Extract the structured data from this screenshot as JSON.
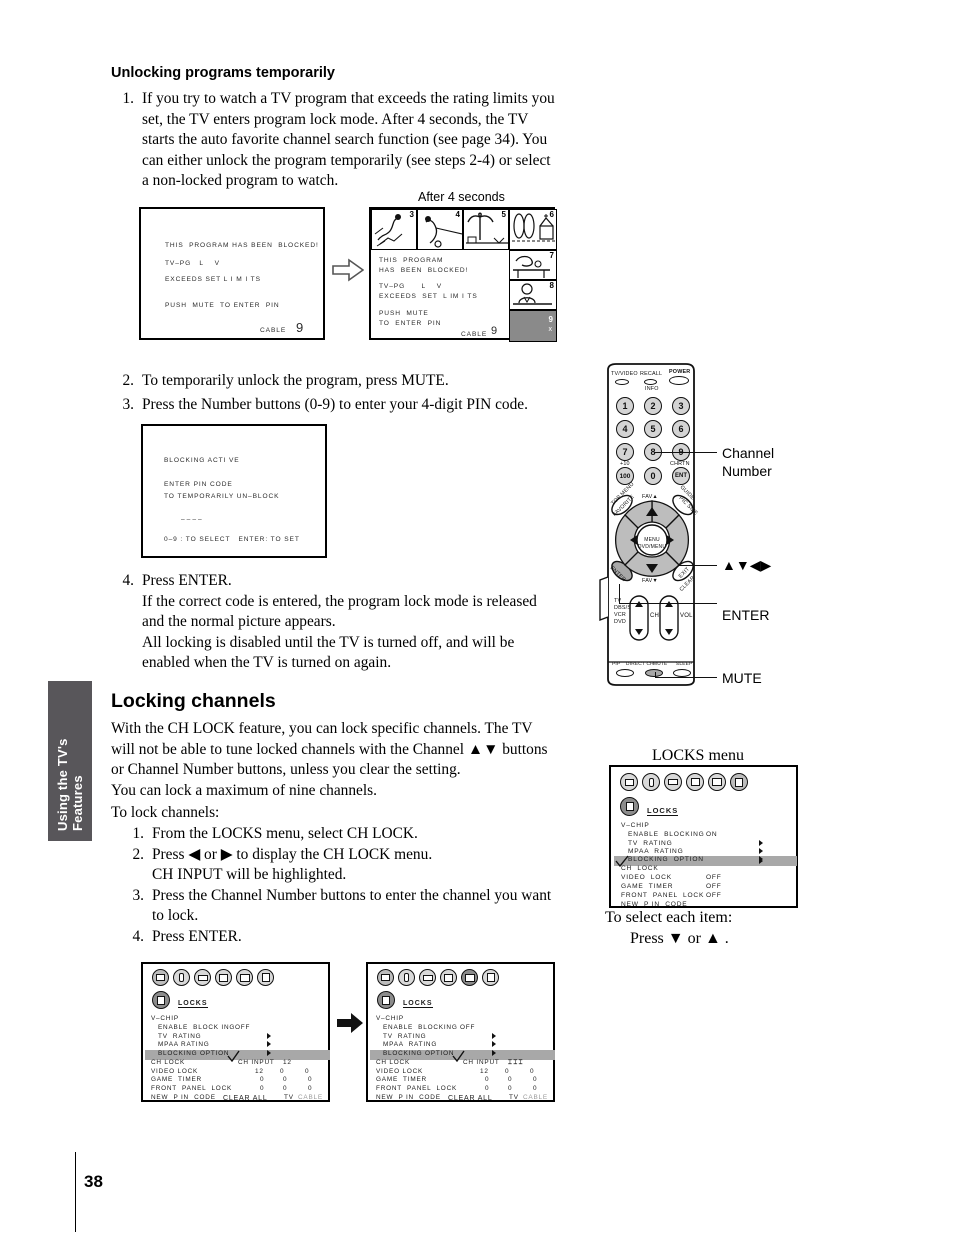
{
  "page": {
    "number": "38",
    "side_tab_line1": "Using the TV's",
    "side_tab_line2": "Features"
  },
  "section1": {
    "heading": "Unlocking programs temporarily",
    "steps": [
      {
        "marker": "1.",
        "text": "If you try to watch a TV program that exceeds the rating limits you set, the TV enters program lock mode. After 4 seconds, the TV starts the auto favorite channel search function (see page 34). You can either unlock the program temporarily (see steps 2-4) or select a non-locked program to watch."
      },
      {
        "marker": "2.",
        "text": "To temporarily unlock the program, press MUTE."
      },
      {
        "marker": "3.",
        "text": "Press the Number buttons (0-9) to enter your 4-digit PIN code."
      },
      {
        "marker": "4.",
        "text": "Press ENTER.",
        "sub1": "If the correct code is entered, the program lock mode is released and the normal picture appears.",
        "sub2": "All locking is disabled until the TV is turned off, and will be enabled when the TV is turned on again."
      }
    ]
  },
  "figure_blocked": {
    "caption_after": "After 4 seconds",
    "screen1": {
      "line1": "THIS  PROGRAM HAS BEEN  BLOCKED!",
      "line2": "TV–PG   L    V",
      "line3": "EXCEEDS SET L I M I TS",
      "line4": "PUSH  MUTE  TO ENTER  PIN",
      "source": "CABLE",
      "channel": "9"
    },
    "screen2": {
      "line1": "THIS  PROGRAM",
      "line2": "HAS  BEEN  BLOCKED!",
      "line3": "TV–PG      L    V",
      "line4": "EXCEEDS  SET  L IM I TS",
      "line5": "PUSH  MUTE",
      "line6": "TO  ENTER  PIN",
      "source": "CABLE",
      "channel": "9",
      "thumb_numbers": [
        "3",
        "4",
        "5",
        "6",
        "7",
        "8",
        "9"
      ],
      "thumb9_mark": "x"
    }
  },
  "figure_pin": {
    "line1": "BLOCKING ACTI VE",
    "line2": "ENTER PIN CODE",
    "line3": "TO TEMPORARILY UN–BLOCK",
    "line4": "––––",
    "line5": "0–9 : TO SELECT   ENTER: TO SET"
  },
  "section2": {
    "heading": "Locking channels",
    "p1": "With the CH LOCK feature, you can lock specific channels. The TV will not be able to tune locked channels with the Channel ▲▼ buttons or Channel Number buttons, unless you clear the setting.",
    "p2": "You can lock a maximum of nine channels.",
    "p3": "To lock channels:",
    "steps": [
      {
        "marker": "1.",
        "text": "From the LOCKS menu, select CH LOCK."
      },
      {
        "marker": "2.",
        "text": "Press ◀ or ▶ to display the CH LOCK menu.",
        "line2": "CH INPUT will be highlighted."
      },
      {
        "marker": "3.",
        "text": "Press the Channel Number buttons to enter the channel you want to lock."
      },
      {
        "marker": "4.",
        "text": "Press ENTER."
      }
    ]
  },
  "remote": {
    "labels": {
      "tv_video": "TV/VIDEO",
      "recall": "RECALL",
      "info": "INFO",
      "power": "POWER",
      "plus10": "+10",
      "chrtn": "CHRTN",
      "ent": "ENT",
      "top_menu": "TOP MENU",
      "favorite": "FAVORITE",
      "guide": "GUIDE",
      "pic_size": "PIC SIZE",
      "fav_up": "FAV▲",
      "fav_down": "FAV▼",
      "menu": "MENU",
      "dvd_menu": "DVD/MENU",
      "enter": "ENTER",
      "exit": "EXIT",
      "clear": "CLEAR",
      "tv": "TV",
      "dbs_sat": "DBS/SAT",
      "vcr": "VCR",
      "dvd": "DVD",
      "ch": "CH",
      "vol": "VOL",
      "pip": "PIP",
      "direct_ch": "DIRECT CH",
      "mute": "MUTE",
      "sleep": "SLEEP"
    },
    "numbers": [
      "1",
      "2",
      "3",
      "4",
      "5",
      "6",
      "7",
      "8",
      "9",
      "100",
      "0",
      "ENT"
    ],
    "callouts": {
      "channel_number_l1": "Channel",
      "channel_number_l2": "Number",
      "arrows": "▲▼◀▶",
      "enter": "ENTER",
      "mute": "MUTE"
    }
  },
  "locks_menu": {
    "title": "LOCKS menu",
    "menu_label": "LOCKS",
    "rows": [
      {
        "label": "V–CHIP",
        "value": "",
        "arrow": false,
        "indent": 0,
        "highlight": false
      },
      {
        "label": "ENABLE  BLOCKING",
        "value": "ON",
        "arrow": false,
        "indent": 1,
        "highlight": false
      },
      {
        "label": "TV  RATING",
        "value": "",
        "arrow": true,
        "indent": 1,
        "highlight": false
      },
      {
        "label": "MPAA  RATING",
        "value": "",
        "arrow": true,
        "indent": 1,
        "highlight": false
      },
      {
        "label": "BLOCKING  OPTION",
        "value": "",
        "arrow": true,
        "indent": 1,
        "highlight": false
      },
      {
        "label": "CH  LOCK",
        "value": "",
        "arrow": true,
        "indent": 0,
        "highlight": true
      },
      {
        "label": "VIDEO  LOCK",
        "value": "OFF",
        "arrow": false,
        "indent": 0,
        "highlight": false
      },
      {
        "label": "GAME  TIMER",
        "value": "OFF",
        "arrow": false,
        "indent": 0,
        "highlight": false
      },
      {
        "label": "FRONT  PANEL  LOCK",
        "value": "OFF",
        "arrow": false,
        "indent": 0,
        "highlight": false
      },
      {
        "label": "NEW  P IN  CODE",
        "value": "",
        "arrow": false,
        "indent": 0,
        "highlight": false
      }
    ],
    "select_hint_l1": "To select each item:",
    "select_hint_l2": "Press ▼ or ▲ ."
  },
  "chlock_menu_a": {
    "menu_label": "LOCKS",
    "rows": [
      {
        "label": "V–CHIP",
        "value": "",
        "indent": 0,
        "arrow": false,
        "highlight": false
      },
      {
        "label": "ENABLE  BLOCK ING",
        "value": "OFF",
        "indent": 1,
        "arrow": false,
        "highlight": false
      },
      {
        "label": "TV  RATING",
        "value": "",
        "indent": 1,
        "arrow": true,
        "highlight": false
      },
      {
        "label": "MPAA RATING",
        "value": "",
        "indent": 1,
        "arrow": true,
        "highlight": false
      },
      {
        "label": "BLOCKING OPTION",
        "value": "",
        "indent": 1,
        "arrow": true,
        "highlight": false
      },
      {
        "label": "CH LOCK",
        "value": "",
        "indent": 0,
        "arrow": false,
        "highlight": true
      },
      {
        "label": "VIDEO LOCK",
        "value": "",
        "indent": 0,
        "arrow": false,
        "highlight": false
      },
      {
        "label": "GAME  TIMER",
        "value": "",
        "indent": 0,
        "arrow": false,
        "highlight": false
      },
      {
        "label": "FRONT  PANEL  LOCK",
        "value": "",
        "indent": 0,
        "arrow": false,
        "highlight": false
      },
      {
        "label": "NEW  P IN  CODE",
        "value": "",
        "indent": 0,
        "arrow": false,
        "highlight": false
      }
    ],
    "ch_input_label": "CH INPUT",
    "ch_input_value": "12",
    "grid": [
      [
        "12",
        "0",
        "0"
      ],
      [
        "0",
        "0",
        "0"
      ],
      [
        "0",
        "0",
        "0"
      ]
    ],
    "tv_label": "TV",
    "cable_label": "CABLE",
    "clear_all": "CLEAR ALL"
  },
  "chlock_menu_b": {
    "menu_label": "LOCKS",
    "rows": [
      {
        "label": "V–CHIP",
        "value": "",
        "indent": 0,
        "arrow": false,
        "highlight": false
      },
      {
        "label": "ENABLE  BLOCKING",
        "value": "OFF",
        "indent": 1,
        "arrow": false,
        "highlight": false
      },
      {
        "label": "TV  RATING",
        "value": "",
        "indent": 1,
        "arrow": true,
        "highlight": false
      },
      {
        "label": "MPAA  RATING",
        "value": "",
        "indent": 1,
        "arrow": true,
        "highlight": false
      },
      {
        "label": "BLOCKING OPTION",
        "value": "",
        "indent": 1,
        "arrow": true,
        "highlight": false
      },
      {
        "label": "CH LOCK",
        "value": "",
        "indent": 0,
        "arrow": false,
        "highlight": true
      },
      {
        "label": "VIDEO LOCK",
        "value": "",
        "indent": 0,
        "arrow": false,
        "highlight": false
      },
      {
        "label": "GAME  TIMER",
        "value": "",
        "indent": 0,
        "arrow": false,
        "highlight": false
      },
      {
        "label": "FRONT  PANEL  LOCK",
        "value": "",
        "indent": 0,
        "arrow": false,
        "highlight": false
      },
      {
        "label": "NEW  P IN  CODE",
        "value": "",
        "indent": 0,
        "arrow": false,
        "highlight": false
      }
    ],
    "ch_input_label": "CH INPUT",
    "ch_input_value": "⌶⌶⌶",
    "grid": [
      [
        "12",
        "0",
        "0"
      ],
      [
        "0",
        "0",
        "0"
      ],
      [
        "0",
        "0",
        "0"
      ]
    ],
    "tv_label": "TV",
    "cable_label": "CABLE",
    "clear_all": "CLEAR ALL"
  },
  "colors": {
    "tab_bg": "#58565a",
    "highlight": "#a8a8a8",
    "icon_fill": "#d9d9d9",
    "remote_key": "#d4d4d4"
  }
}
